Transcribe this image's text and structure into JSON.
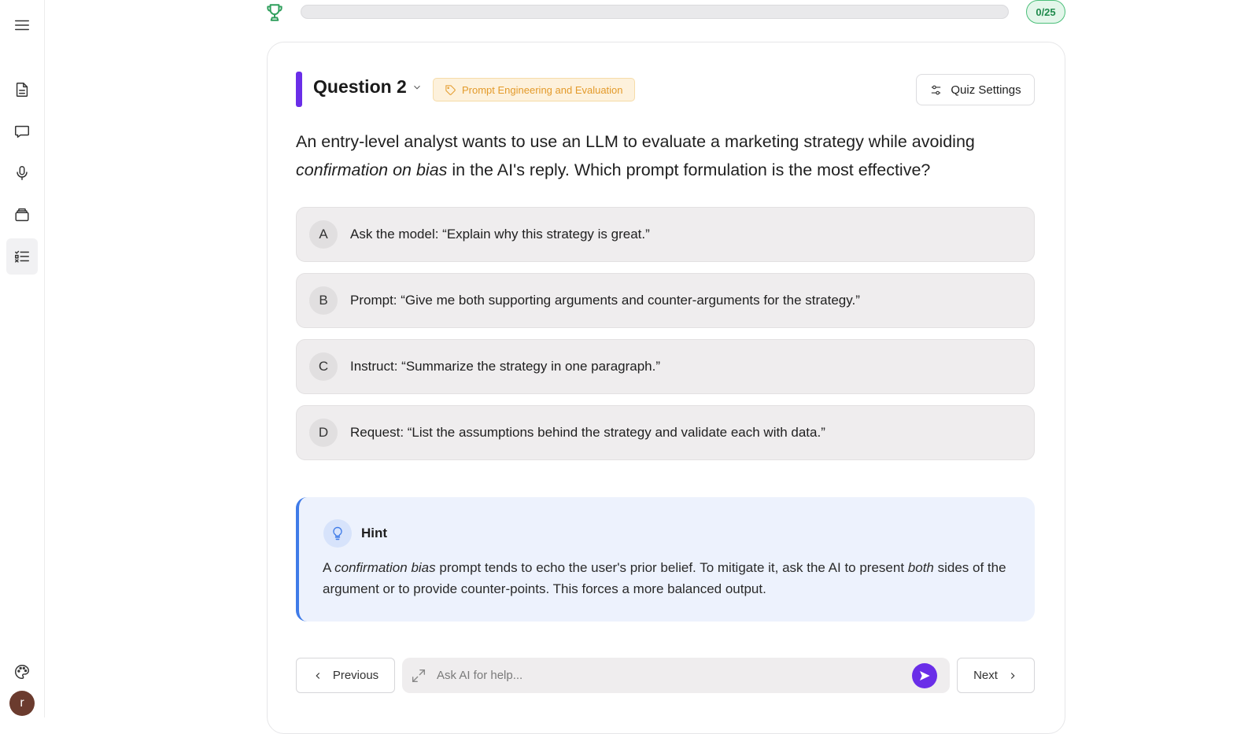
{
  "sidebar": {
    "items": [
      {
        "name": "menu-icon"
      },
      {
        "name": "document-icon"
      },
      {
        "name": "chat-bubble-icon"
      },
      {
        "name": "microphone-icon"
      },
      {
        "name": "cards-icon"
      },
      {
        "name": "quiz-list-icon",
        "active": true
      }
    ],
    "bottom": [
      {
        "name": "palette-icon"
      }
    ],
    "avatar_initial": "r"
  },
  "progress": {
    "count_label": "0/25",
    "fraction": 0,
    "accent_color": "#2e9e5b"
  },
  "question": {
    "title": "Question 2",
    "topic": "Prompt Engineering and Evaluation",
    "settings_label": "Quiz Settings",
    "text_part1": "An entry-level analyst wants to use an LLM to evaluate a marketing strategy while avoiding ",
    "text_emph": "confirmation on bias",
    "text_part2": " in the AI's reply. Which prompt formulation is the most effective?",
    "accent_color": "#6a2ee8"
  },
  "options": [
    {
      "letter": "A",
      "text": "Ask the model: “Explain why this strategy is great.”"
    },
    {
      "letter": "B",
      "text": "Prompt: “Give me both supporting arguments and counter-arguments for the strategy.”"
    },
    {
      "letter": "C",
      "text": "Instruct: “Summarize the strategy in one paragraph.”"
    },
    {
      "letter": "D",
      "text": "Request: “List the assumptions behind the strategy and validate each with data.”"
    }
  ],
  "hint": {
    "title": "Hint",
    "seg1": "A ",
    "seg2": "confirmation bias",
    "seg3": " prompt tends to echo the user's prior belief. To mitigate it, ask the AI to present ",
    "seg4": "both",
    "seg5": " sides of the argument or to provide counter-points. This forces a more balanced output.",
    "accent_color": "#3f7be8"
  },
  "footer": {
    "previous_label": "Previous",
    "next_label": "Next",
    "ask_placeholder": "Ask AI for help..."
  }
}
